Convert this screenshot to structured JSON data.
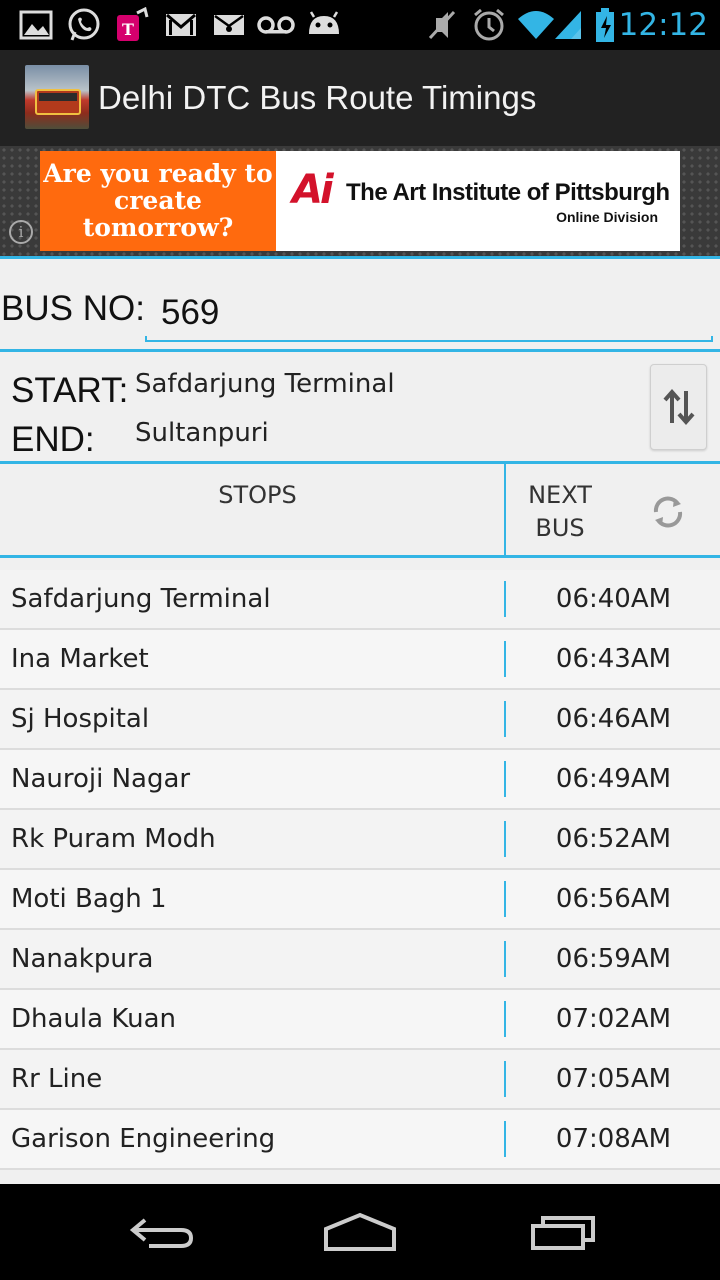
{
  "status_bar": {
    "time": "12:12",
    "left_icons": [
      "gallery-icon",
      "whatsapp-icon",
      "tmobile-icon",
      "gmail-icon",
      "email-icon",
      "voicemail-icon",
      "android-icon"
    ],
    "right_icons": [
      "mute-icon",
      "alarm-icon",
      "wifi-icon",
      "signal-icon",
      "battery-icon"
    ]
  },
  "action_bar": {
    "title": "Delhi DTC Bus Route Timings",
    "icon": "bus-app-icon"
  },
  "ad": {
    "left_text": "Are you ready to create tomorrow?",
    "logo": "Ai",
    "name": "The Art Institute of Pittsburgh",
    "subtitle": "Online Division",
    "info_glyph": "i"
  },
  "route": {
    "bus_no_label": "BUS NO:",
    "bus_no_value": "569",
    "start_label": "START:",
    "start_value": "Safdarjung Terminal",
    "end_label": "END:",
    "end_value": "Sultanpuri",
    "swap_icon": "swap-direction-icon"
  },
  "table": {
    "col_stops": "STOPS",
    "col_next_line1": "NEXT",
    "col_next_line2": "BUS",
    "refresh_icon": "refresh-icon",
    "rows": [
      {
        "stop": "Safdarjung Terminal",
        "time": "06:40AM"
      },
      {
        "stop": "Ina Market",
        "time": "06:43AM"
      },
      {
        "stop": "Sj Hospital",
        "time": "06:46AM"
      },
      {
        "stop": "Nauroji Nagar",
        "time": "06:49AM"
      },
      {
        "stop": "Rk Puram Modh",
        "time": "06:52AM"
      },
      {
        "stop": "Moti Bagh 1",
        "time": "06:56AM"
      },
      {
        "stop": "Nanakpura",
        "time": "06:59AM"
      },
      {
        "stop": "Dhaula Kuan",
        "time": "07:02AM"
      },
      {
        "stop": "Rr Line",
        "time": "07:05AM"
      },
      {
        "stop": "Garison Engineering",
        "time": "07:08AM"
      }
    ]
  },
  "nav_bar": {
    "buttons": [
      "back-icon",
      "home-icon",
      "recents-icon"
    ]
  },
  "colors": {
    "accent": "#33b5e5",
    "action_bar": "#222222",
    "content_bg": "#f0f0f0",
    "ad_orange": "#ff6a0e"
  }
}
